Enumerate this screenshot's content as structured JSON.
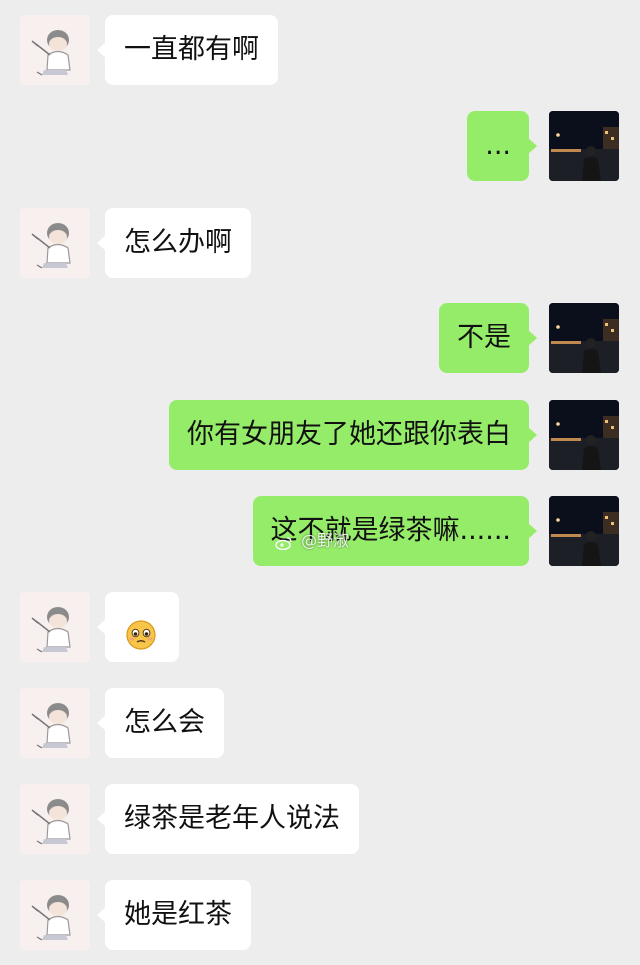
{
  "messages": [
    {
      "side": "in",
      "text": "一直都有啊"
    },
    {
      "side": "out",
      "text": "..."
    },
    {
      "side": "in",
      "text": "怎么办啊"
    },
    {
      "side": "out",
      "text": "不是"
    },
    {
      "side": "out",
      "text": "你有女朋友了她还跟你表白"
    },
    {
      "side": "out",
      "text": "这不就是绿茶嘛......"
    },
    {
      "side": "in",
      "text": "",
      "emoji": "woozy-face-emoji"
    },
    {
      "side": "in",
      "text": "怎么会"
    },
    {
      "side": "in",
      "text": "绿茶是老年人说法"
    },
    {
      "side": "in",
      "text": "她是红茶"
    }
  ],
  "watermark": {
    "text": "@野淑"
  },
  "colors": {
    "background": "#ededed",
    "incoming_bubble": "#ffffff",
    "outgoing_bubble": "#95ec69"
  }
}
